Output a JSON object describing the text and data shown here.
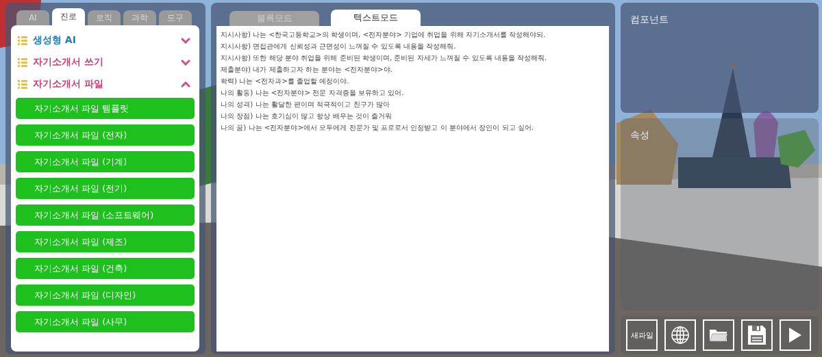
{
  "category_tabs": [
    {
      "label": "AI",
      "selected": false
    },
    {
      "label": "진로",
      "selected": true
    },
    {
      "label": "로직",
      "selected": false
    },
    {
      "label": "과학",
      "selected": false
    },
    {
      "label": "도구",
      "selected": false
    }
  ],
  "categories": [
    {
      "title": "생성형 AI",
      "color": "#1e7fc0",
      "expanded": false
    },
    {
      "title": "자기소개서 쓰기",
      "color": "#c8407a",
      "expanded": false
    },
    {
      "title": "자기소개서 파일",
      "color": "#c8407a",
      "expanded": true,
      "items": [
        "자기소개서 파일 템플릿",
        "자기소개서 파일 (전자)",
        "자기소개서 파일 (기계)",
        "자기소개서 파일 (전기)",
        "자기소개서 파일 (소프트웨어)",
        "자기소개서 파일 (제조)",
        "자기소개서 파일 (건축)",
        "자기소개서 파일 (디자인)",
        "자기소개서 파일 (사무)"
      ]
    }
  ],
  "editor_tabs": [
    {
      "label": "블록모드",
      "selected": false
    },
    {
      "label": "텍스트모드",
      "selected": true
    }
  ],
  "editor_lines": [
    "지시사항) 나는 <한국고등학교>의 학생이며, <전자분야> 기업에 취업을 위해 자기소개서를 작성해야되.",
    "지시사항) 면접관에게 신뢰성과 근면성이 느껴질 수 있도록 내용을 작성해줘.",
    "지시사항) 또한 해당 분야 취업을 위해 준비된 학생이며, 준비된 자세가 느껴질 수 있도록 내용을 작성해줘.",
    "제출분야) 내가 제출하고자 하는 분야는 <전자분야>야.",
    "학력) 나는 <전자과>를 졸업할 예정이야.",
    "나의 활동) 나는 <전자분야> 전문 자격증을 보유하고 있어.",
    "나의 성격) 나는 활달한 편이며 적극적이고 친구가 많아",
    "나의 장점) 나는 호기심이 많고 항상 배우는 것이 즐거워",
    "나의 꿈) 나는 <전자분야>에서 모두에게 전문가 및 프로로서 인정받고 이 분야에서 장인이 되고 싶어."
  ],
  "components_panel": {
    "title": "컴포넌트"
  },
  "properties_panel": {
    "title": "속성"
  },
  "toolbar": [
    {
      "kind": "text",
      "label": "새파일"
    },
    {
      "kind": "globe"
    },
    {
      "kind": "folder"
    },
    {
      "kind": "save"
    },
    {
      "kind": "play"
    }
  ]
}
